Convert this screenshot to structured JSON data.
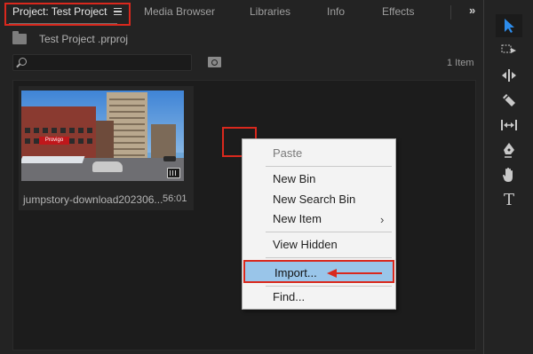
{
  "tabs": [
    {
      "label": "Project: Test Project",
      "active": true
    },
    {
      "label": "Media Browser"
    },
    {
      "label": "Libraries"
    },
    {
      "label": "Info"
    },
    {
      "label": "Effects"
    }
  ],
  "tab_overflow_label": "»",
  "project": {
    "path": "Test Project .prproj",
    "search_value": "",
    "item_count": "1 Item"
  },
  "clip": {
    "name": "jumpstory-download202306...",
    "duration": "56:01",
    "sign_text": "Provigo"
  },
  "context_menu": {
    "items": [
      {
        "label": "Paste",
        "disabled": true
      },
      {
        "label": "New Bin"
      },
      {
        "label": "New Search Bin"
      },
      {
        "label": "New Item",
        "submenu": true
      },
      {
        "label": "View Hidden"
      },
      {
        "label": "Import...",
        "highlighted": true
      },
      {
        "label": "Find..."
      }
    ],
    "submenu_arrow": "›"
  },
  "tools": [
    {
      "icon": "selection-arrow-icon",
      "selected": true
    },
    {
      "icon": "track-select-icon"
    },
    {
      "icon": "ripple-edit-icon"
    },
    {
      "icon": "razor-icon"
    },
    {
      "icon": "slip-icon"
    },
    {
      "icon": "pen-icon"
    },
    {
      "icon": "hand-icon"
    },
    {
      "icon": "type-icon",
      "glyph": "T"
    }
  ],
  "colors": {
    "annotation_red": "#d9281d",
    "menu_highlight": "#99c5e9",
    "tool_accent": "#2d8ceb"
  }
}
